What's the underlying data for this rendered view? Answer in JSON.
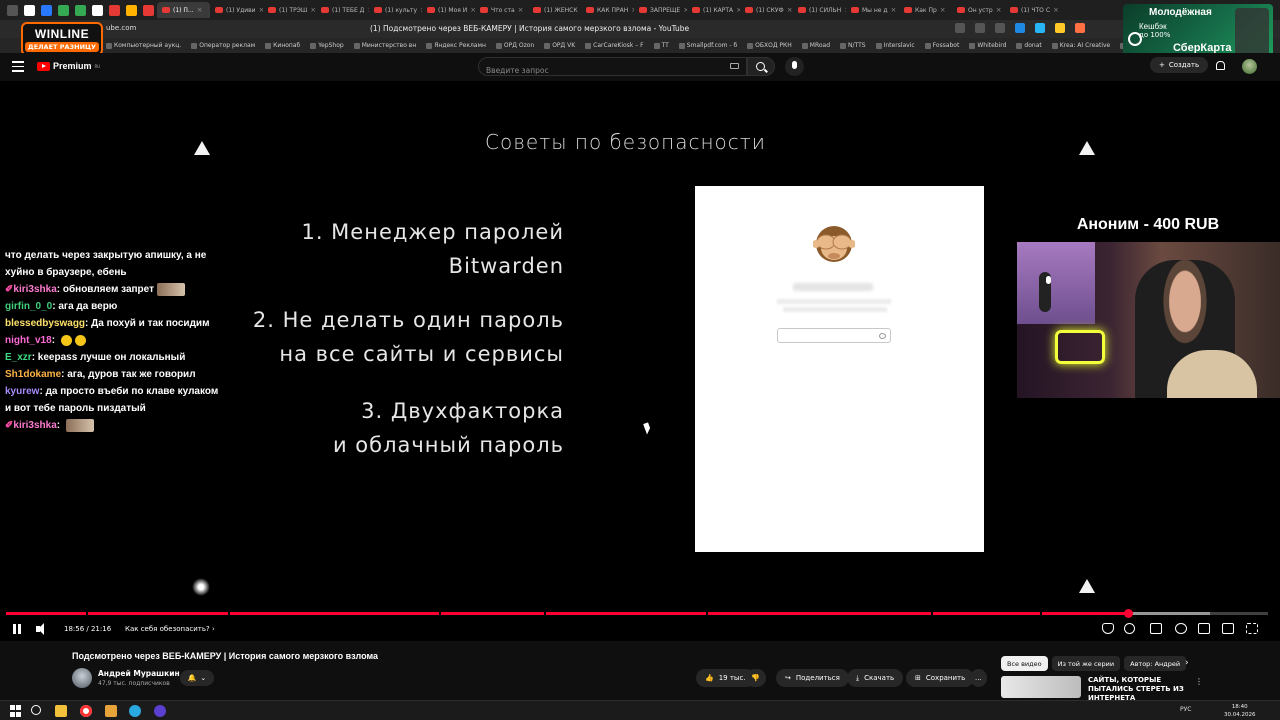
{
  "browser": {
    "tabs": [
      {
        "label": "(1) П..."
      },
      {
        "label": "(1) Удиви"
      },
      {
        "label": "(1) ТРЭШ"
      },
      {
        "label": "(1) ТЕБЕ Д"
      },
      {
        "label": "(1) культу"
      },
      {
        "label": "(1) Моя И"
      },
      {
        "label": "Что ста"
      },
      {
        "label": "(1) ЖЕНСК"
      },
      {
        "label": "КАК ПРАН"
      },
      {
        "label": "ЗАПРЕЩЕ"
      },
      {
        "label": "(1) КАРТА"
      },
      {
        "label": "(1) СКУФ"
      },
      {
        "label": "(1) СИЛЬН"
      },
      {
        "label": "Мы не д"
      },
      {
        "label": "Как Пр"
      },
      {
        "label": "Он устр"
      },
      {
        "label": "(1) ЧТО С"
      }
    ],
    "url": "ube.com",
    "page_title": "(1) Подсмотрено через ВЕБ-КАМЕРУ | История самого мерзкого взлома - YouTube",
    "bookmarks": [
      "Компьютерный аукц.",
      "Оператор реклам",
      "Кинопаб",
      "YepShop",
      "Министерство вн",
      "Яндекс Рекламн",
      "ОРД Ozon",
      "ОРД VK",
      "CarCareKiosk – F",
      "TT",
      "Smallpdf.com - б",
      "ОБХОД РКН",
      "MRoad",
      "N/TTS",
      "Interslavic",
      "Fossabot",
      "Whitebird",
      "donat",
      "Krea: AI Creative",
      "кобальт"
    ]
  },
  "ads": {
    "winline_brand": "WINLINE",
    "winline_slogan": "ДЕЛАЕТ РАЗНИЦУ",
    "sber_line1": "Молодёжная",
    "sber_line2": "Кешбэк",
    "sber_line3": "до 100%",
    "sber_line4": "СберКарта"
  },
  "youtube": {
    "logo_label": "Premium",
    "logo_region": "RU",
    "search_placeholder": "Введите запрос",
    "create_label": "Создать"
  },
  "slide": {
    "title": "Советы по безопасности",
    "tips": [
      {
        "line1": "1. Менеджер паролей",
        "line2": "Bitwarden"
      },
      {
        "line1": "2. Не делать один пароль",
        "line2": "на все сайты и сервисы"
      },
      {
        "line1": "3. Двухфакторка",
        "line2": "и облачный пароль"
      }
    ]
  },
  "chat": [
    {
      "user": "",
      "text": "что делать через закрытую апишку, а не хуйно в браузере, ебень",
      "user_color": "#ffffff"
    },
    {
      "user": "kiri3shka",
      "text": "обновляем запрет",
      "user_color": "#ff7bd0",
      "badge": true,
      "emote": true
    },
    {
      "user": "girfin_0_0",
      "text": "ага да верю",
      "user_color": "#3fd17c"
    },
    {
      "user": "blessedbyswagg",
      "text": "Да похуй и так посидим",
      "user_color": "#ffe26a"
    },
    {
      "user": "night_v18",
      "text": "",
      "user_color": "#ff6ad5",
      "yellow_emotes": 2
    },
    {
      "user": "E_xzr",
      "text": "keepass лучше он локальный",
      "user_color": "#3ddc84"
    },
    {
      "user": "Sh1dokame",
      "text": "ага, дуров так же говорил",
      "user_color": "#ffb347"
    },
    {
      "user": "kyurew",
      "text": "да просто въеби по клаве кулаком и вот тебе пароль пиздатый",
      "user_color": "#a78bfa"
    },
    {
      "user": "kiri3shka",
      "text": "",
      "user_color": "#ff7bd0",
      "badge": true,
      "emote": true
    }
  ],
  "donation": {
    "text": "Аноним - 400 RUB"
  },
  "player": {
    "time": "18:56 / 21:16",
    "chapter": "Как себя обезопасить?",
    "progress_fraction": 0.889
  },
  "video": {
    "title": "Подсмотрено через ВЕБ-КАМЕРУ | История самого мерзкого взлома",
    "channel": "Андрей Мурашкин",
    "subscribers": "47,9 тыс. подписчиков",
    "likes": "19 тыс.",
    "share_label": "Поделиться",
    "download_label": "Скачать",
    "save_label": "Сохранить",
    "more_label": "...",
    "chips": [
      "Все видео",
      "Из той же серии",
      "Автор: Андрей"
    ],
    "rec_title": "САЙТЫ, КОТОРЫЕ ПЫТАЛИСЬ СТЕРЕТЬ ИЗ ИНТЕРНЕТА"
  },
  "taskbar": {
    "lang": "РУС",
    "time": "18:40",
    "date": "30.04.2026"
  },
  "colors": {
    "youtube_red": "#ff0000",
    "progress_red": "#ff0033",
    "winline_orange": "#ff6a00"
  }
}
